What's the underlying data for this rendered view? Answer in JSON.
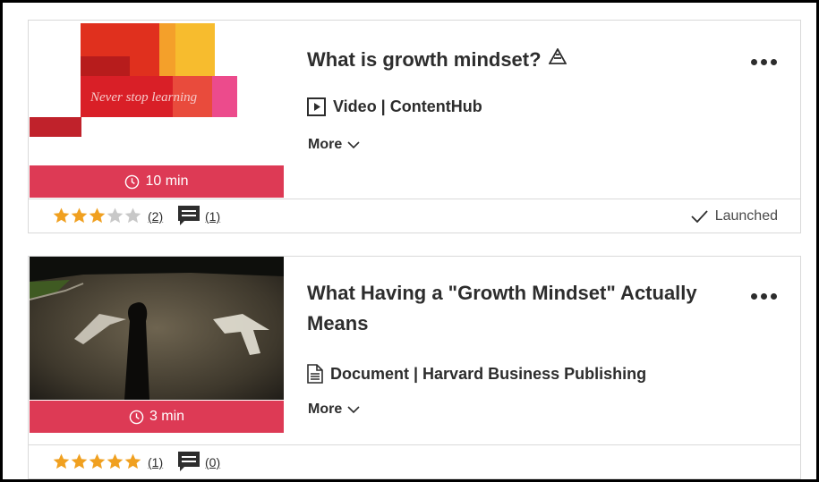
{
  "items": [
    {
      "title": "What is growth mindset?",
      "title_badge_icon": "mountain-icon",
      "thumbnail_text": "Never stop learning",
      "duration": "10 min",
      "type_icon": "play-icon",
      "type_label": "Video | ContentHub",
      "more_label": "More",
      "rating": 3,
      "rating_max": 5,
      "rating_count": "(2)",
      "comment_count": "(1)",
      "status": "Launched"
    },
    {
      "title": "What Having a \"Growth Mindset\" Actually Means",
      "thumbnail_alt": "shadow-on-road-arrows",
      "duration": "3 min",
      "type_icon": "document-icon",
      "type_label": "Document | Harvard Business Publishing",
      "more_label": "More",
      "rating": 5,
      "rating_max": 5,
      "rating_count": "(1)",
      "comment_count": "(0)"
    }
  ],
  "colors": {
    "duration_bar": "#dd3a55",
    "star_filled": "#f0a020",
    "star_empty": "#c8c8c8",
    "text": "#2d2d2d"
  }
}
